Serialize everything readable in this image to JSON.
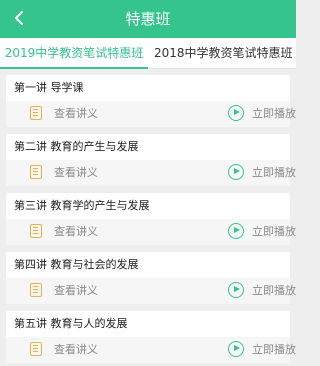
{
  "header": {
    "title": "特惠班",
    "back_icon": "chevron-left-icon"
  },
  "tabs": [
    {
      "label": "2019中学教资笔试特惠班",
      "active": true
    },
    {
      "label": "2018中学教资笔试特惠班",
      "active": false
    }
  ],
  "lessons": [
    {
      "title": "第一讲  导学课",
      "notes_label": "查看讲义",
      "play_label": "立即播放"
    },
    {
      "title": "第二讲  教育的产生与发展",
      "notes_label": "查看讲义",
      "play_label": "立即播放"
    },
    {
      "title": "第三讲  教育学的产生与发展",
      "notes_label": "查看讲义",
      "play_label": "立即播放"
    },
    {
      "title": "第四讲  教育与社会的发展",
      "notes_label": "查看讲义",
      "play_label": "立即播放"
    },
    {
      "title": "第五讲  教育与人的发展",
      "notes_label": "查看讲义",
      "play_label": "立即播放"
    }
  ],
  "colors": {
    "accent": "#35c48e",
    "doc_icon": "#e9b248",
    "background": "#eeeeee"
  }
}
